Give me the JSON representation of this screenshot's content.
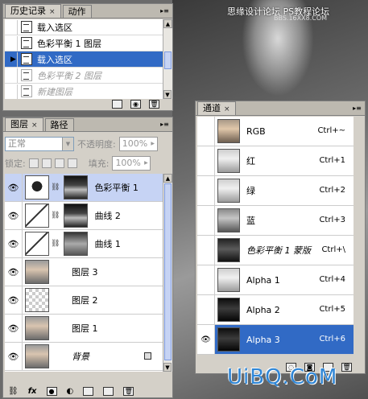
{
  "watermarks": {
    "top": "思缘设计论坛  PS教程论坛",
    "top_sub": "BBS.16XX8.COM",
    "bottom": "UiBQ.CoM"
  },
  "history_panel": {
    "tabs": [
      "历史记录",
      "动作"
    ],
    "items": [
      {
        "label": "载入选区",
        "state": "normal"
      },
      {
        "label": "色彩平衡 1 图层",
        "state": "normal"
      },
      {
        "label": "载入选区",
        "state": "selected"
      },
      {
        "label": "色彩平衡 2 图层",
        "state": "dimmed"
      },
      {
        "label": "新建图层",
        "state": "dimmed"
      }
    ]
  },
  "layers_panel": {
    "tabs": [
      "图层",
      "路径"
    ],
    "blend_mode": "正常",
    "opacity_label": "不透明度:",
    "opacity_value": "100%",
    "lock_label": "锁定:",
    "fill_label": "填充:",
    "fill_value": "100%",
    "layers": [
      {
        "name": "色彩平衡 1",
        "type": "adjustment",
        "active": true
      },
      {
        "name": "曲线 2",
        "type": "adjustment"
      },
      {
        "name": "曲线 1",
        "type": "adjustment"
      },
      {
        "name": "图层 3",
        "type": "photo"
      },
      {
        "name": "图层 2",
        "type": "transparent"
      },
      {
        "name": "图层 1",
        "type": "photo"
      },
      {
        "name": "背景",
        "type": "background"
      }
    ],
    "footer_icons": [
      "link-icon",
      "fx-icon",
      "mask-icon",
      "adjustment-icon",
      "folder-icon",
      "new-layer-icon",
      "trash-icon"
    ]
  },
  "channels_panel": {
    "tabs": [
      "通道"
    ],
    "channels": [
      {
        "name": "RGB",
        "shortcut": "Ctrl+~"
      },
      {
        "name": "红",
        "shortcut": "Ctrl+1"
      },
      {
        "name": "绿",
        "shortcut": "Ctrl+2"
      },
      {
        "name": "蓝",
        "shortcut": "Ctrl+3"
      },
      {
        "name": "色彩平衡 1 蒙版",
        "shortcut": "Ctrl+\\"
      },
      {
        "name": "Alpha 1",
        "shortcut": "Ctrl+4"
      },
      {
        "name": "Alpha 2",
        "shortcut": "Ctrl+5"
      },
      {
        "name": "Alpha 3",
        "shortcut": "Ctrl+6"
      }
    ]
  }
}
